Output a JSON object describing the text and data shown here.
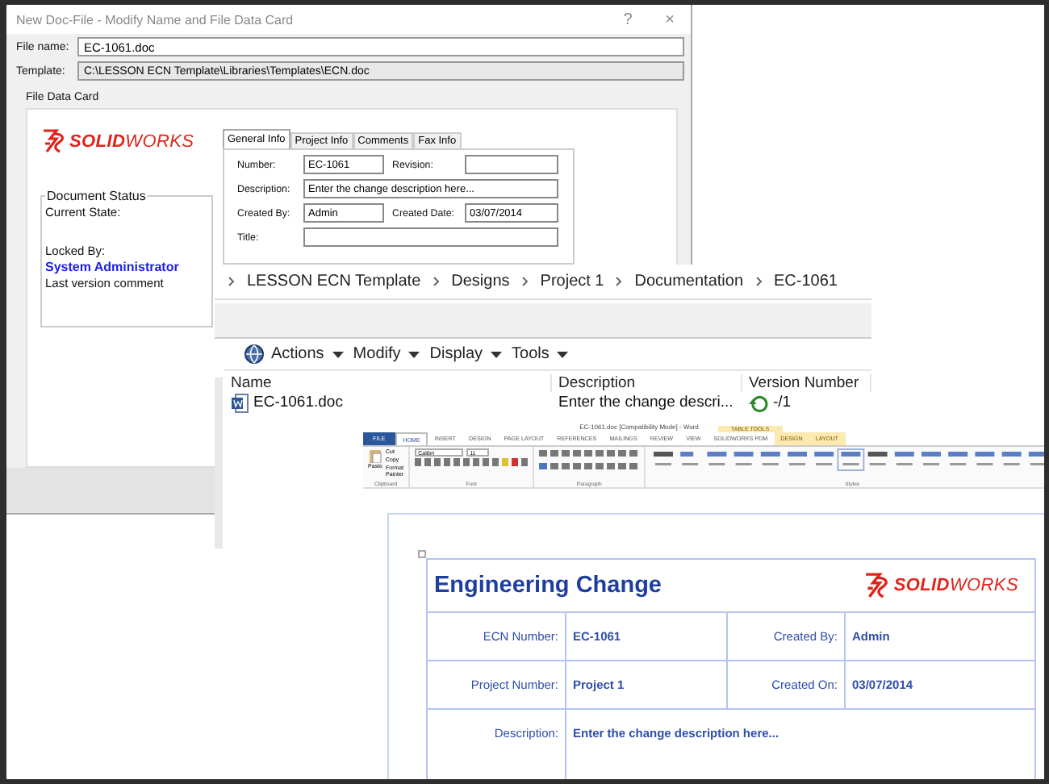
{
  "dialog": {
    "title": "New Doc-File - Modify Name and File Data Card",
    "help_button": "?",
    "close_button": "×",
    "file_name": {
      "label": "File name:",
      "value": "EC-1061.doc"
    },
    "template": {
      "label": "Template:",
      "value": "C:\\LESSON ECN Template\\Libraries\\Templates\\ECN.doc"
    },
    "data_card": {
      "title": "File Data Card",
      "logo": "**SOLID**WORKS",
      "tabs": [
        {
          "label": "General Info",
          "selected": true
        },
        {
          "label": "Project Info",
          "selected": false
        },
        {
          "label": "Comments",
          "selected": false
        },
        {
          "label": "Fax Info",
          "selected": false
        }
      ],
      "rows": [
        [
          {
            "label": "Number:",
            "value": "EC-1061"
          },
          {
            "label": "Revision:"
          }
        ],
        [
          {
            "label": "Description:",
            "value": "Enter the change description here..."
          }
        ],
        [
          {
            "label": "Created By:",
            "value": "Admin"
          },
          {
            "label": "Created Date:",
            "value": "03/07/2014"
          }
        ],
        [
          {
            "label": "Title:"
          }
        ]
      ],
      "document_status": {
        "title": "Document Status",
        "current_state_label": "Current State:",
        "locked_by_label": "Locked By:",
        "locked_by": "System Administrator",
        "last_version_comment": "Last version comment"
      }
    }
  },
  "explorer": {
    "breadcrumb": [
      "LESSON ECN Template",
      "Designs",
      "Project 1",
      "Documentation",
      "EC-1061"
    ],
    "menus": [
      "Actions",
      "Modify",
      "Display",
      "Tools"
    ],
    "columns": [
      "Name",
      "Description",
      "Version Number"
    ],
    "rows": [
      {
        "name": "EC-1061.doc",
        "description": "Enter the change descri...",
        "version": "-/1"
      }
    ]
  },
  "word": {
    "title": "EC-1061.doc [Compatibility Mode] - Word",
    "contextual_group": "TABLE TOOLS",
    "tabs": [
      {
        "label": "FILE",
        "kind": "file",
        "selected": false
      },
      {
        "label": "HOME",
        "kind": "tab",
        "selected": true
      },
      {
        "label": "INSERT",
        "kind": "tab",
        "selected": false
      },
      {
        "label": "DESIGN",
        "kind": "tab",
        "selected": false
      },
      {
        "label": "PAGE LAYOUT",
        "kind": "tab",
        "selected": false
      },
      {
        "label": "REFERENCES",
        "kind": "tab",
        "selected": false
      },
      {
        "label": "MAILINGS",
        "kind": "tab",
        "selected": false
      },
      {
        "label": "REVIEW",
        "kind": "tab",
        "selected": false
      },
      {
        "label": "VIEW",
        "kind": "tab",
        "selected": false
      },
      {
        "label": "SOLIDWORKS PDM",
        "kind": "tab",
        "selected": false
      },
      {
        "label": "DESIGN",
        "kind": "contextual",
        "selected": false
      },
      {
        "label": "LAYOUT",
        "kind": "contextual",
        "selected": false
      }
    ],
    "clipboard": {
      "paste": "Paste",
      "items": [
        "Cut",
        "Copy",
        "Format Painter"
      ],
      "label": "Clipboard"
    },
    "font": {
      "name": "Calibri",
      "size": "11",
      "label": "Font"
    },
    "paragraph": {
      "label": "Paragraph"
    },
    "styles": {
      "label": "Styles"
    }
  },
  "document": {
    "heading": "Engineering Change",
    "logo": "**SOLID**WORKS",
    "rows": [
      [
        {
          "label": "ECN Number:",
          "value": "EC-1061"
        },
        {
          "label": "Created By:",
          "value": "Admin"
        }
      ],
      [
        {
          "label": "Project Number:",
          "value": "Project 1"
        },
        {
          "label": "Created On:",
          "value": "03/07/2014"
        }
      ],
      [
        {
          "label": "Description:",
          "value": "Enter the change description here..."
        }
      ]
    ]
  }
}
